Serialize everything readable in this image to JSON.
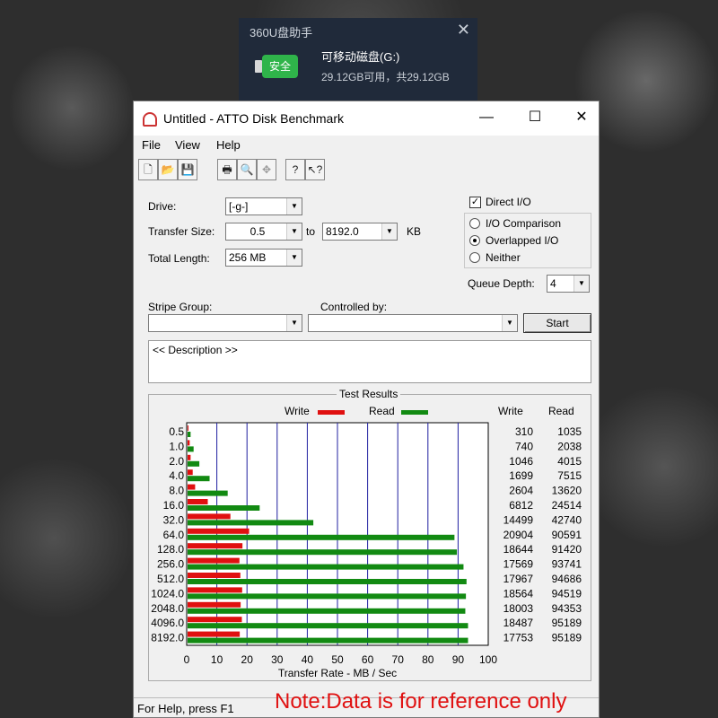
{
  "popup": {
    "title": "360U盘助手",
    "badge": "安全",
    "drive_name": "可移动磁盘(G:)",
    "drive_size": "29.12GB可用，共29.12GB"
  },
  "window": {
    "title": "Untitled - ATTO Disk Benchmark",
    "menu": [
      "File",
      "View",
      "Help"
    ]
  },
  "form": {
    "drive_label": "Drive:",
    "drive_value": "[-g-]",
    "transfer_label": "Transfer Size:",
    "transfer_from": "0.5",
    "transfer_to_label": "to",
    "transfer_to": "8192.0",
    "transfer_unit": "KB",
    "length_label": "Total Length:",
    "length_value": "256 MB",
    "direct_io": "Direct I/O",
    "direct_io_checked": true,
    "io_comparison": "I/O Comparison",
    "overlapped_io": "Overlapped I/O",
    "neither": "Neither",
    "queue_label": "Queue Depth:",
    "queue_value": "4",
    "stripe_label": "Stripe Group:",
    "controlled_label": "Controlled by:",
    "start_label": "Start",
    "description": "<< Description >>"
  },
  "results": {
    "title": "Test Results",
    "legend_write": "Write",
    "legend_read": "Read",
    "col_write": "Write",
    "col_read": "Read"
  },
  "status": "For Help, press F1",
  "note": "Note:Data is for reference only",
  "colors": {
    "write": "#e01010",
    "read": "#128a12",
    "grid": "#2020a0"
  },
  "chart_data": {
    "type": "bar",
    "orientation": "horizontal",
    "title": "Test Results",
    "xlabel": "Transfer Rate - MB / Sec",
    "xlim": [
      0,
      100
    ],
    "xticks": [
      0,
      10,
      20,
      30,
      40,
      50,
      60,
      70,
      80,
      90,
      100
    ],
    "categories": [
      "0.5",
      "1.0",
      "2.0",
      "4.0",
      "8.0",
      "16.0",
      "32.0",
      "64.0",
      "128.0",
      "256.0",
      "512.0",
      "1024.0",
      "2048.0",
      "4096.0",
      "8192.0"
    ],
    "series": [
      {
        "name": "Write",
        "values": [
          0.3,
          0.7,
          1.0,
          1.7,
          2.5,
          6.7,
          14.2,
          20.4,
          18.2,
          17.2,
          17.5,
          18.1,
          17.6,
          18.0,
          17.3
        ]
      },
      {
        "name": "Read",
        "values": [
          1.0,
          2.0,
          3.9,
          7.3,
          13.3,
          23.9,
          41.7,
          88.5,
          89.3,
          91.5,
          92.5,
          92.3,
          92.1,
          93.0,
          93.0
        ]
      }
    ],
    "write_values": [
      310,
      740,
      1046,
      1699,
      2604,
      6812,
      14499,
      20904,
      18644,
      17569,
      17967,
      18564,
      18003,
      18487,
      17753
    ],
    "read_values": [
      1035,
      2038,
      4015,
      7515,
      13620,
      24514,
      42740,
      90591,
      91420,
      93741,
      94686,
      94519,
      94353,
      95189,
      95189
    ],
    "legend": "top-center",
    "grid": true
  }
}
